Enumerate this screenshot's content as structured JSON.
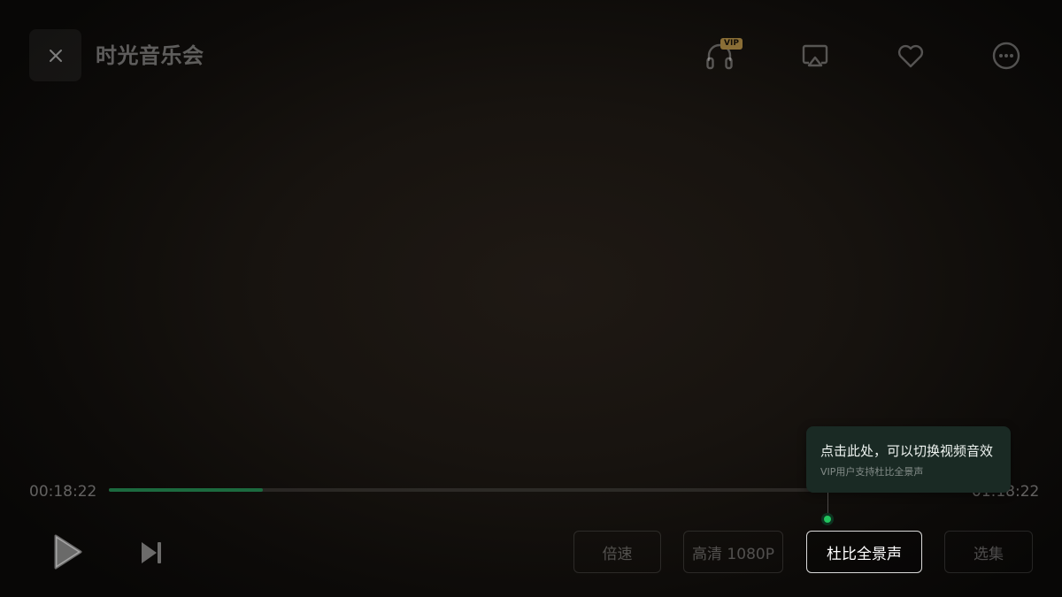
{
  "header": {
    "title": "时光音乐会",
    "close_icon": "close-icon",
    "icons": [
      {
        "name": "headphones-icon",
        "badge": "VIP"
      },
      {
        "name": "cast-screen-icon"
      },
      {
        "name": "heart-icon"
      },
      {
        "name": "more-icon"
      }
    ]
  },
  "progress": {
    "current_time": "00:18:22",
    "total_time": "01:18:22",
    "played_fraction": 0.18
  },
  "controls": {
    "play_icon": "play-icon",
    "next_icon": "skip-next-icon",
    "speed_label": "倍速",
    "quality_label": "高清 1080P",
    "audio_label": "杜比全景声",
    "episodes_label": "选集"
  },
  "tooltip": {
    "title": "点击此处，可以切换视频音效",
    "subtitle": "VIP用户支持杜比全景声"
  },
  "colors": {
    "accent_green": "#22c45e",
    "progress_fill": "#1c6a3f",
    "vip_gold": "#8a6e36",
    "tooltip_bg": "#1a2a24"
  }
}
